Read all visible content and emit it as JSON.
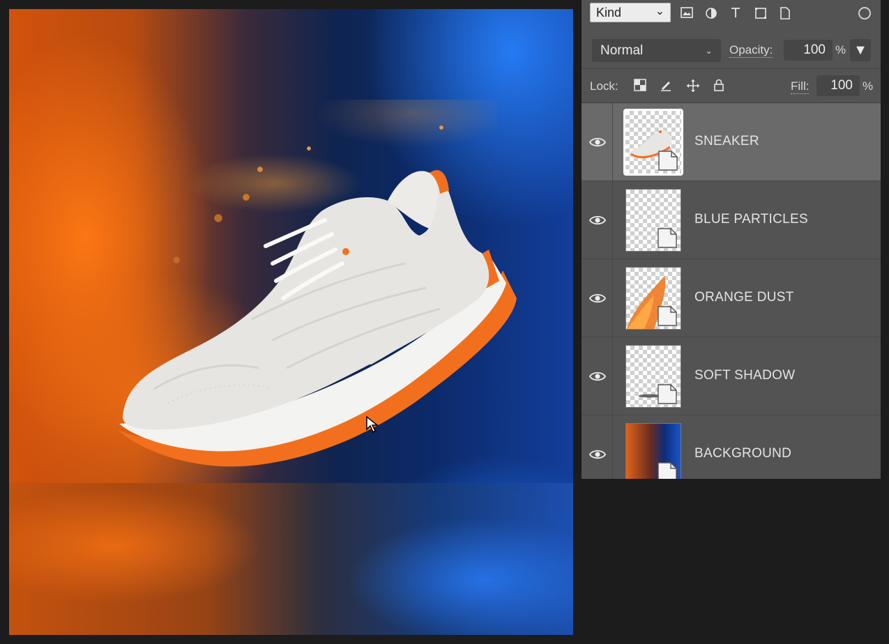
{
  "canvas": {
    "description_icons": [
      "sneaker-image",
      "mouse-pointer-icon"
    ]
  },
  "layers_panel": {
    "filter": {
      "kind_label": "Kind",
      "icons": [
        "image-filter-icon",
        "adjustment-filter-icon",
        "type-filter-icon",
        "shape-filter-icon",
        "smart-object-filter-icon",
        "filter-toggle-icon"
      ]
    },
    "blend": {
      "mode": "Normal",
      "opacity_label": "Opacity:",
      "opacity_value": "100",
      "percent": "%"
    },
    "lock": {
      "label": "Lock:",
      "icons": [
        "lock-transparent-pixels-icon",
        "lock-image-pixels-icon",
        "lock-position-icon",
        "lock-all-icon"
      ],
      "fill_label": "Fill:",
      "fill_value": "100",
      "percent": "%"
    },
    "layers": [
      {
        "name": "SNEAKER",
        "visible": true,
        "selected": true
      },
      {
        "name": "BLUE PARTICLES",
        "visible": true,
        "selected": false
      },
      {
        "name": "ORANGE DUST",
        "visible": true,
        "selected": false
      },
      {
        "name": "SOFT SHADOW",
        "visible": true,
        "selected": false
      },
      {
        "name": "BACKGROUND",
        "visible": true,
        "selected": false
      }
    ]
  },
  "colors": {
    "accent_orange": "#f26a1b",
    "panel_bg": "#535353",
    "selected_row": "#6a6a6a"
  }
}
